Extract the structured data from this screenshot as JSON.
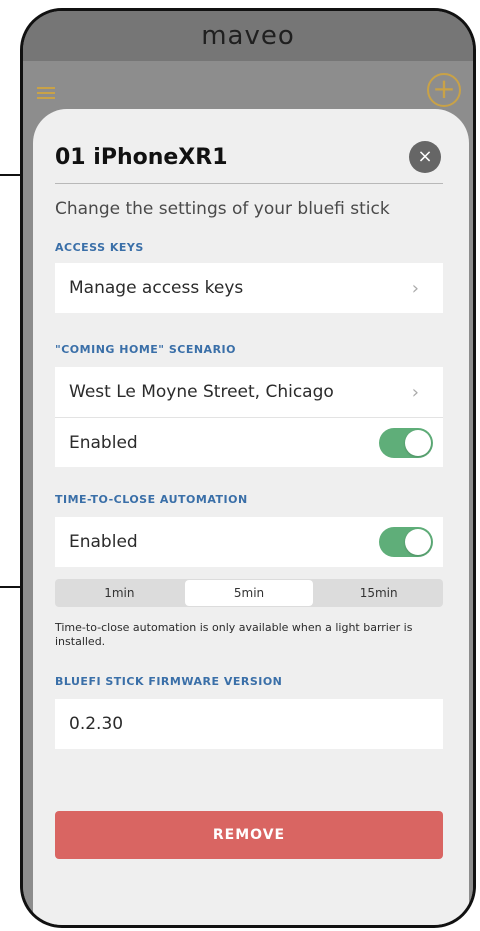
{
  "app": {
    "logo_text": "maveo",
    "colors": {
      "accent_gold": "#c9a247",
      "section_blue": "#3a6fa8",
      "toggle_green": "#5fae79",
      "danger_red": "#d96562"
    }
  },
  "sheet": {
    "title": "01 iPhoneXR1",
    "close_icon": "×",
    "subtitle": "Change the settings of your bluefi stick",
    "sections": {
      "access_keys": {
        "label": "ACCESS KEYS",
        "row_label": "Manage access keys"
      },
      "coming_home": {
        "label": "\"COMING HOME\" SCENARIO",
        "address": "West Le Moyne Street, Chicago",
        "enabled_label": "Enabled",
        "enabled": true
      },
      "time_to_close": {
        "label": "TIME-TO-CLOSE AUTOMATION",
        "enabled_label": "Enabled",
        "enabled": true,
        "options": [
          "1min",
          "5min",
          "15min"
        ],
        "selected": "5min",
        "note": "Time-to-close automation is only available when a light barrier is installed."
      },
      "firmware": {
        "label": "BLUEFI STICK FIRMWARE VERSION",
        "version": "0.2.30"
      }
    },
    "remove_label": "REMOVE"
  }
}
